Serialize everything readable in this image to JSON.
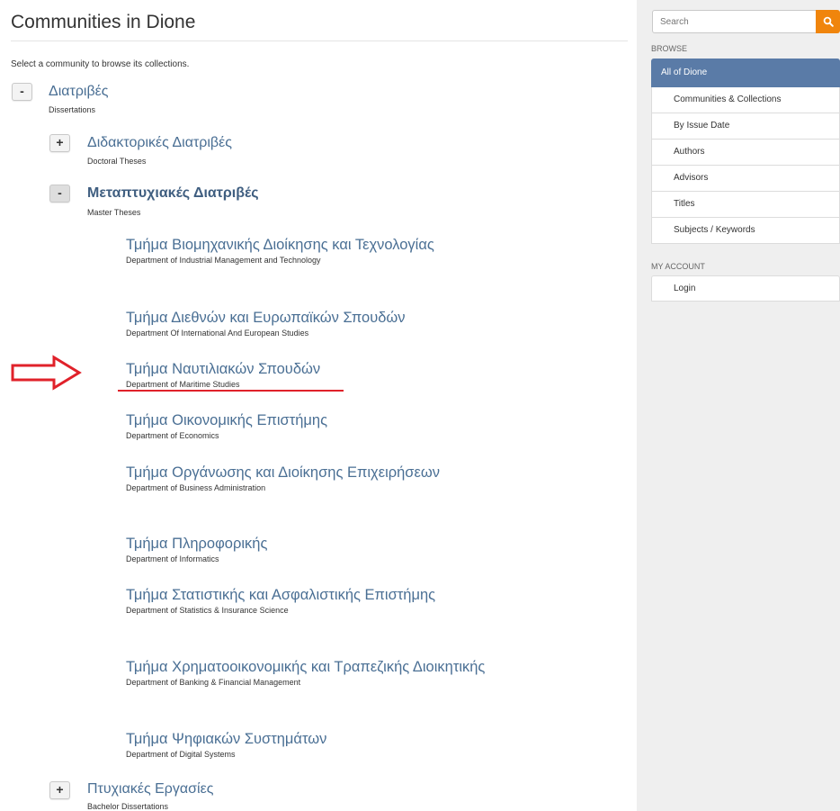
{
  "page": {
    "title": "Communities in Dione",
    "intro": "Select a community to browse its collections."
  },
  "tree": {
    "root": {
      "toggle": "-",
      "title": "Διατριβές",
      "subtitle": "Dissertations"
    },
    "doctoral": {
      "toggle": "+",
      "title": "Διδακτορικές Διατριβές",
      "subtitle": "Doctoral Theses"
    },
    "master": {
      "toggle": "-",
      "title": "Μεταπτυχιακές Διατριβές",
      "subtitle": "Master Theses"
    },
    "bachelor": {
      "toggle": "+",
      "title": "Πτυχιακές Εργασίες",
      "subtitle": "Bachelor Dissertations"
    },
    "collections": [
      {
        "title": "Τμήμα Βιομηχανικής Διοίκησης και Τεχνολογίας",
        "subtitle": "Department of Industrial Management and Technology"
      },
      {
        "title": "Τμήμα Διεθνών και Ευρωπαϊκών Σπουδών",
        "subtitle": "Department Of International And European Studies"
      },
      {
        "title": "Τμήμα Ναυτιλιακών Σπουδών",
        "subtitle": "Department of Maritime Studies"
      },
      {
        "title": "Τμήμα Οικονομικής Επιστήμης",
        "subtitle": "Department of Economics"
      },
      {
        "title": "Τμήμα Οργάνωσης και Διοίκησης Επιχειρήσεων",
        "subtitle": "Department of Business Administration"
      },
      {
        "title": "Τμήμα Πληροφορικής",
        "subtitle": "Department of Informatics"
      },
      {
        "title": "Τμήμα Στατιστικής και Ασφαλιστικής Επιστήμης",
        "subtitle": "Department of Statistics & Insurance Science"
      },
      {
        "title": "Τμήμα Χρηματοοικονομικής και Τραπεζικής Διοικητικής",
        "subtitle": "Department of Banking & Financial Management"
      },
      {
        "title": "Τμήμα Ψηφιακών Συστημάτων",
        "subtitle": "Department of Digital Systems"
      }
    ]
  },
  "annotation": {
    "arrow_color": "#e0212a"
  },
  "sidebar": {
    "search_placeholder": "Search",
    "search_icon": "search-icon",
    "browse_label": "BROWSE",
    "browse_active": "All of Dione",
    "browse_items": [
      "Communities & Collections",
      "By Issue Date",
      "Authors",
      "Advisors",
      "Titles",
      "Subjects / Keywords"
    ],
    "account_label": "MY ACCOUNT",
    "account_items": [
      "Login"
    ]
  },
  "colors": {
    "link": "#4a6f94",
    "accent_orange": "#f0850c",
    "active_blue": "#5a7ba7"
  }
}
